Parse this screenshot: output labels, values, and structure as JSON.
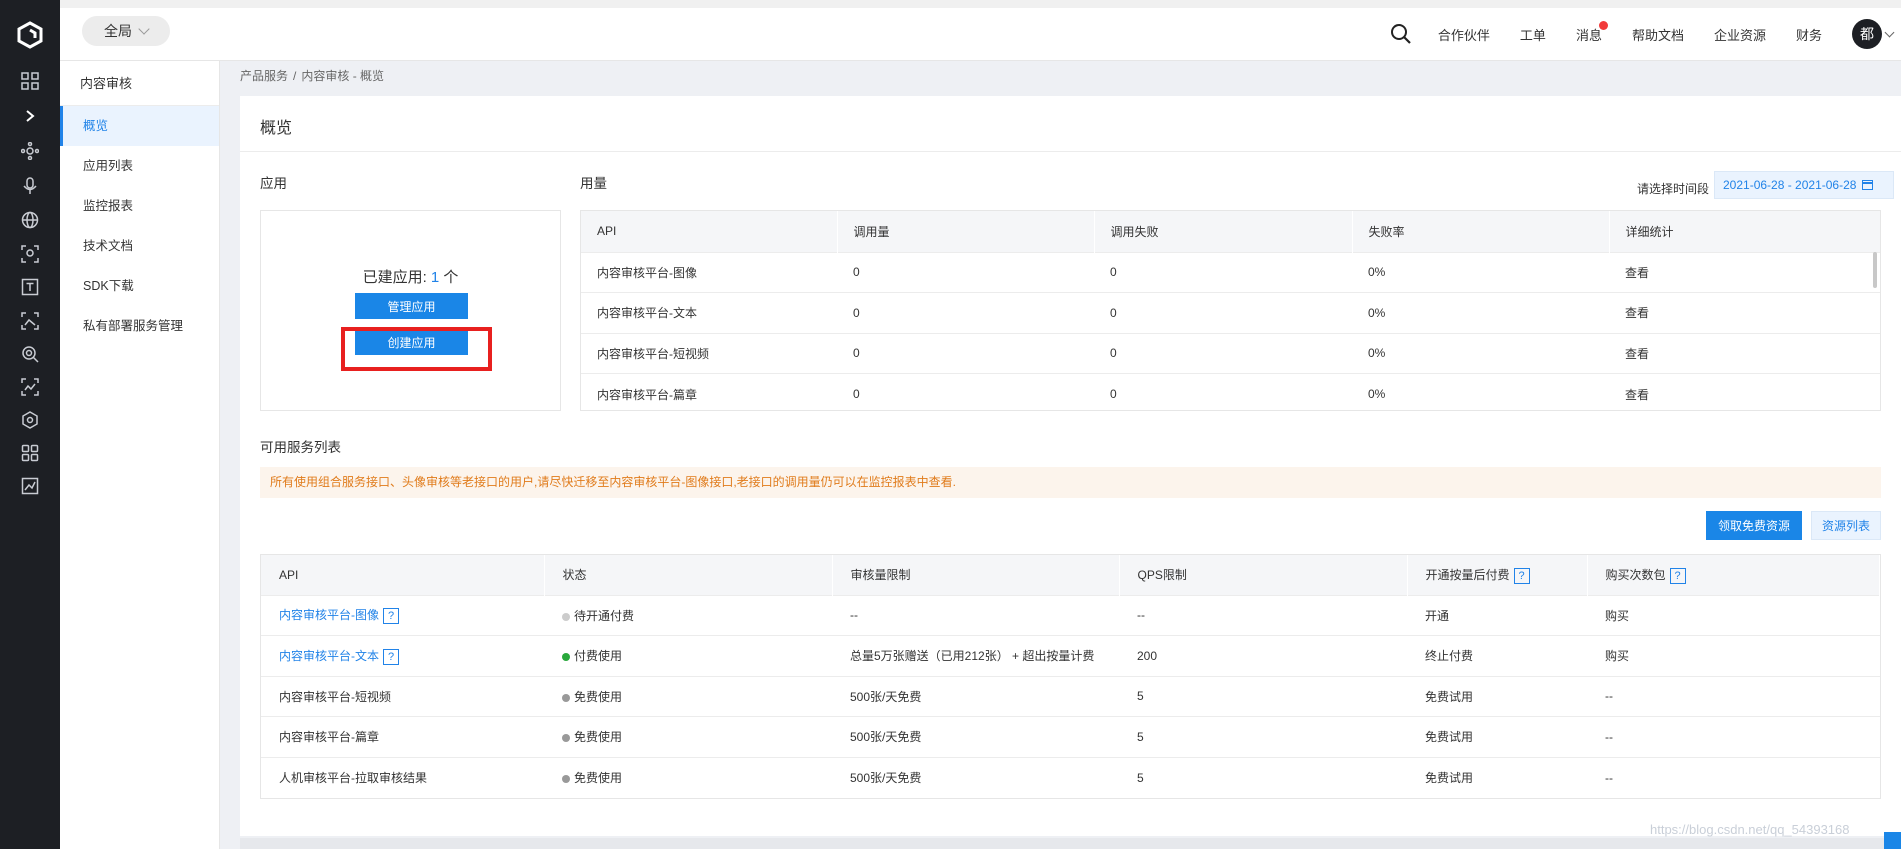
{
  "topbar": {
    "scope_label": "全局",
    "nav": [
      "合作伙伴",
      "工单",
      "消息",
      "帮助文档",
      "企业资源",
      "财务"
    ],
    "avatar_char": "都"
  },
  "rail_icons": [
    "grid-icon",
    "chevron-right-icon",
    "network-icon",
    "microphone-icon",
    "globe-icon",
    "scan-face-icon",
    "text-box-icon",
    "image-recognition-icon",
    "camera-search-icon",
    "image-analysis-icon",
    "cube-icon",
    "apps-icon",
    "chart-box-icon"
  ],
  "subnav": {
    "title": "内容审核",
    "items": [
      "概览",
      "应用列表",
      "监控报表",
      "技术文档",
      "SDK下载",
      "私有部署服务管理"
    ],
    "active_index": 0
  },
  "breadcrumb": [
    "产品服务",
    "内容审核 - 概览"
  ],
  "page_title": "概览",
  "app_section": {
    "label": "应用",
    "count_prefix": "已建应用:",
    "count": "1",
    "count_suffix": "个",
    "manage_button": "管理应用",
    "create_button": "创建应用"
  },
  "usage": {
    "label": "用量",
    "date_label": "请选择时间段",
    "date_range": "2021-06-28 - 2021-06-28",
    "columns": [
      "API",
      "调用量",
      "调用失败",
      "失败率",
      "详细统计"
    ],
    "rows": [
      {
        "api": "内容审核平台-图像",
        "calls": "0",
        "fails": "0",
        "rate": "0%",
        "action": "查看"
      },
      {
        "api": "内容审核平台-文本",
        "calls": "0",
        "fails": "0",
        "rate": "0%",
        "action": "查看"
      },
      {
        "api": "内容审核平台-短视频",
        "calls": "0",
        "fails": "0",
        "rate": "0%",
        "action": "查看"
      },
      {
        "api": "内容审核平台-篇章",
        "calls": "0",
        "fails": "0",
        "rate": "0%",
        "action": "查看"
      }
    ]
  },
  "services": {
    "label": "可用服务列表",
    "notice": "所有使用组合服务接口、头像审核等老接口的用户,请尽快迁移至内容审核平台-图像接口,老接口的调用量仍可以在监控报表中查看.",
    "free_resource_button": "领取免费资源",
    "resource_list_button": "资源列表",
    "help_mark": "?",
    "columns": [
      "API",
      "状态",
      "审核量限制",
      "QPS限制",
      "开通按量后付费",
      "购买次数包"
    ],
    "rows": [
      {
        "api": "内容审核平台-图像",
        "api_link": true,
        "status": "待开通付费",
        "status_color": "#cccccc",
        "limit": "--",
        "qps": "--",
        "postpaid": "开通",
        "postpaid_link": true,
        "package": "购买",
        "package_link": true
      },
      {
        "api": "内容审核平台-文本",
        "api_link": true,
        "status": "付费使用",
        "status_color": "#29a83c",
        "limit": "总量5万张赠送（已用212张） + 超出按量计费",
        "qps": "200",
        "postpaid": "终止付费",
        "postpaid_link": true,
        "package": "购买",
        "package_link": true
      },
      {
        "api": "内容审核平台-短视频",
        "api_link": false,
        "status": "免费使用",
        "status_color": "#999999",
        "limit": "500张/天免费",
        "qps": "5",
        "postpaid": "免费试用",
        "postpaid_link": false,
        "package": "--",
        "package_link": false
      },
      {
        "api": "内容审核平台-篇章",
        "api_link": false,
        "status": "免费使用",
        "status_color": "#999999",
        "limit": "500张/天免费",
        "qps": "5",
        "postpaid": "免费试用",
        "postpaid_link": false,
        "package": "--",
        "package_link": false
      },
      {
        "api": "人机审核平台-拉取审核结果",
        "api_link": false,
        "status": "免费使用",
        "status_color": "#999999",
        "limit": "500张/天免费",
        "qps": "5",
        "postpaid": "免费试用",
        "postpaid_link": false,
        "package": "--",
        "package_link": false
      }
    ]
  },
  "watermark": "https://blog.csdn.net/qq_54393168",
  "colors": {
    "accent": "#1a86e7",
    "highlight": "#e8201f",
    "notice_text": "#e07b1b",
    "dark_rail": "#1d1f24"
  }
}
